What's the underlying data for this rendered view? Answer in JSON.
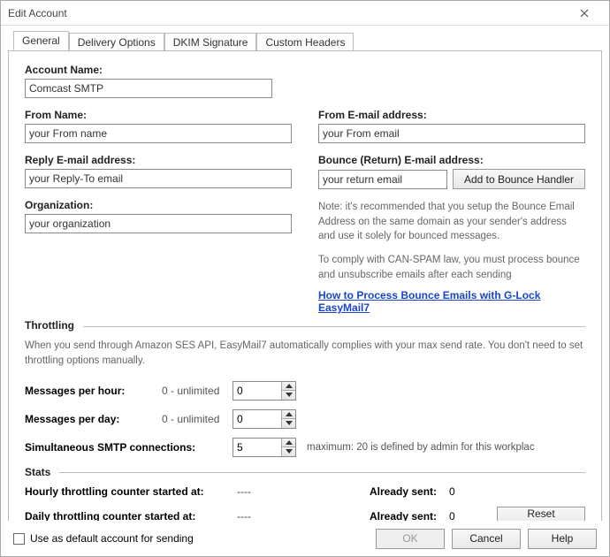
{
  "window": {
    "title": "Edit Account"
  },
  "tabs": [
    "General",
    "Delivery Options",
    "DKIM Signature",
    "Custom Headers"
  ],
  "general": {
    "account_name_label": "Account Name:",
    "account_name_value": "Comcast SMTP",
    "from_name_label": "From Name:",
    "from_name_value": "your From name",
    "from_email_label": "From E-mail address:",
    "from_email_value": "your From email",
    "reply_email_label": "Reply E-mail address:",
    "reply_email_value": "your Reply-To email",
    "bounce_email_label": "Bounce (Return) E-mail address:",
    "bounce_email_value": "your return email",
    "add_bounce_btn": "Add to Bounce Handler",
    "organization_label": "Organization:",
    "organization_value": "your organization",
    "bounce_note1": "Note: it's recommended that you setup the Bounce Email Address on the same domain as your sender's address and use it solely for bounced messages.",
    "bounce_note2": "To comply with CAN-SPAM law, you must process bounce and unsubscribe emails after each sending",
    "bounce_link": "How to Process Bounce Emails with G-Lock EasyMail7"
  },
  "throttling": {
    "section": "Throttling",
    "note": "When you send through Amazon SES API, EasyMail7 automatically complies with your max send rate. You don't need to set throttling options manually.",
    "msgs_hour_label": "Messages per hour:",
    "msgs_hour_hint": "0 - unlimited",
    "msgs_hour_value": "0",
    "msgs_day_label": "Messages per day:",
    "msgs_day_hint": "0 - unlimited",
    "msgs_day_value": "0",
    "smtp_conn_label": "Simultaneous SMTP connections:",
    "smtp_conn_value": "5",
    "smtp_conn_note": "maximum: 20 is defined by admin for this workplac"
  },
  "stats": {
    "section": "Stats",
    "hourly_label": "Hourly throttling counter started at:",
    "hourly_value": "----",
    "daily_label": "Daily throttling counter started at:",
    "daily_value": "----",
    "already_sent_label": "Already sent:",
    "hourly_sent": "0",
    "daily_sent": "0",
    "reset_btn": "Reset counters"
  },
  "footer": {
    "default_account_label": "Use as default account for sending",
    "ok": "OK",
    "cancel": "Cancel",
    "help": "Help"
  }
}
